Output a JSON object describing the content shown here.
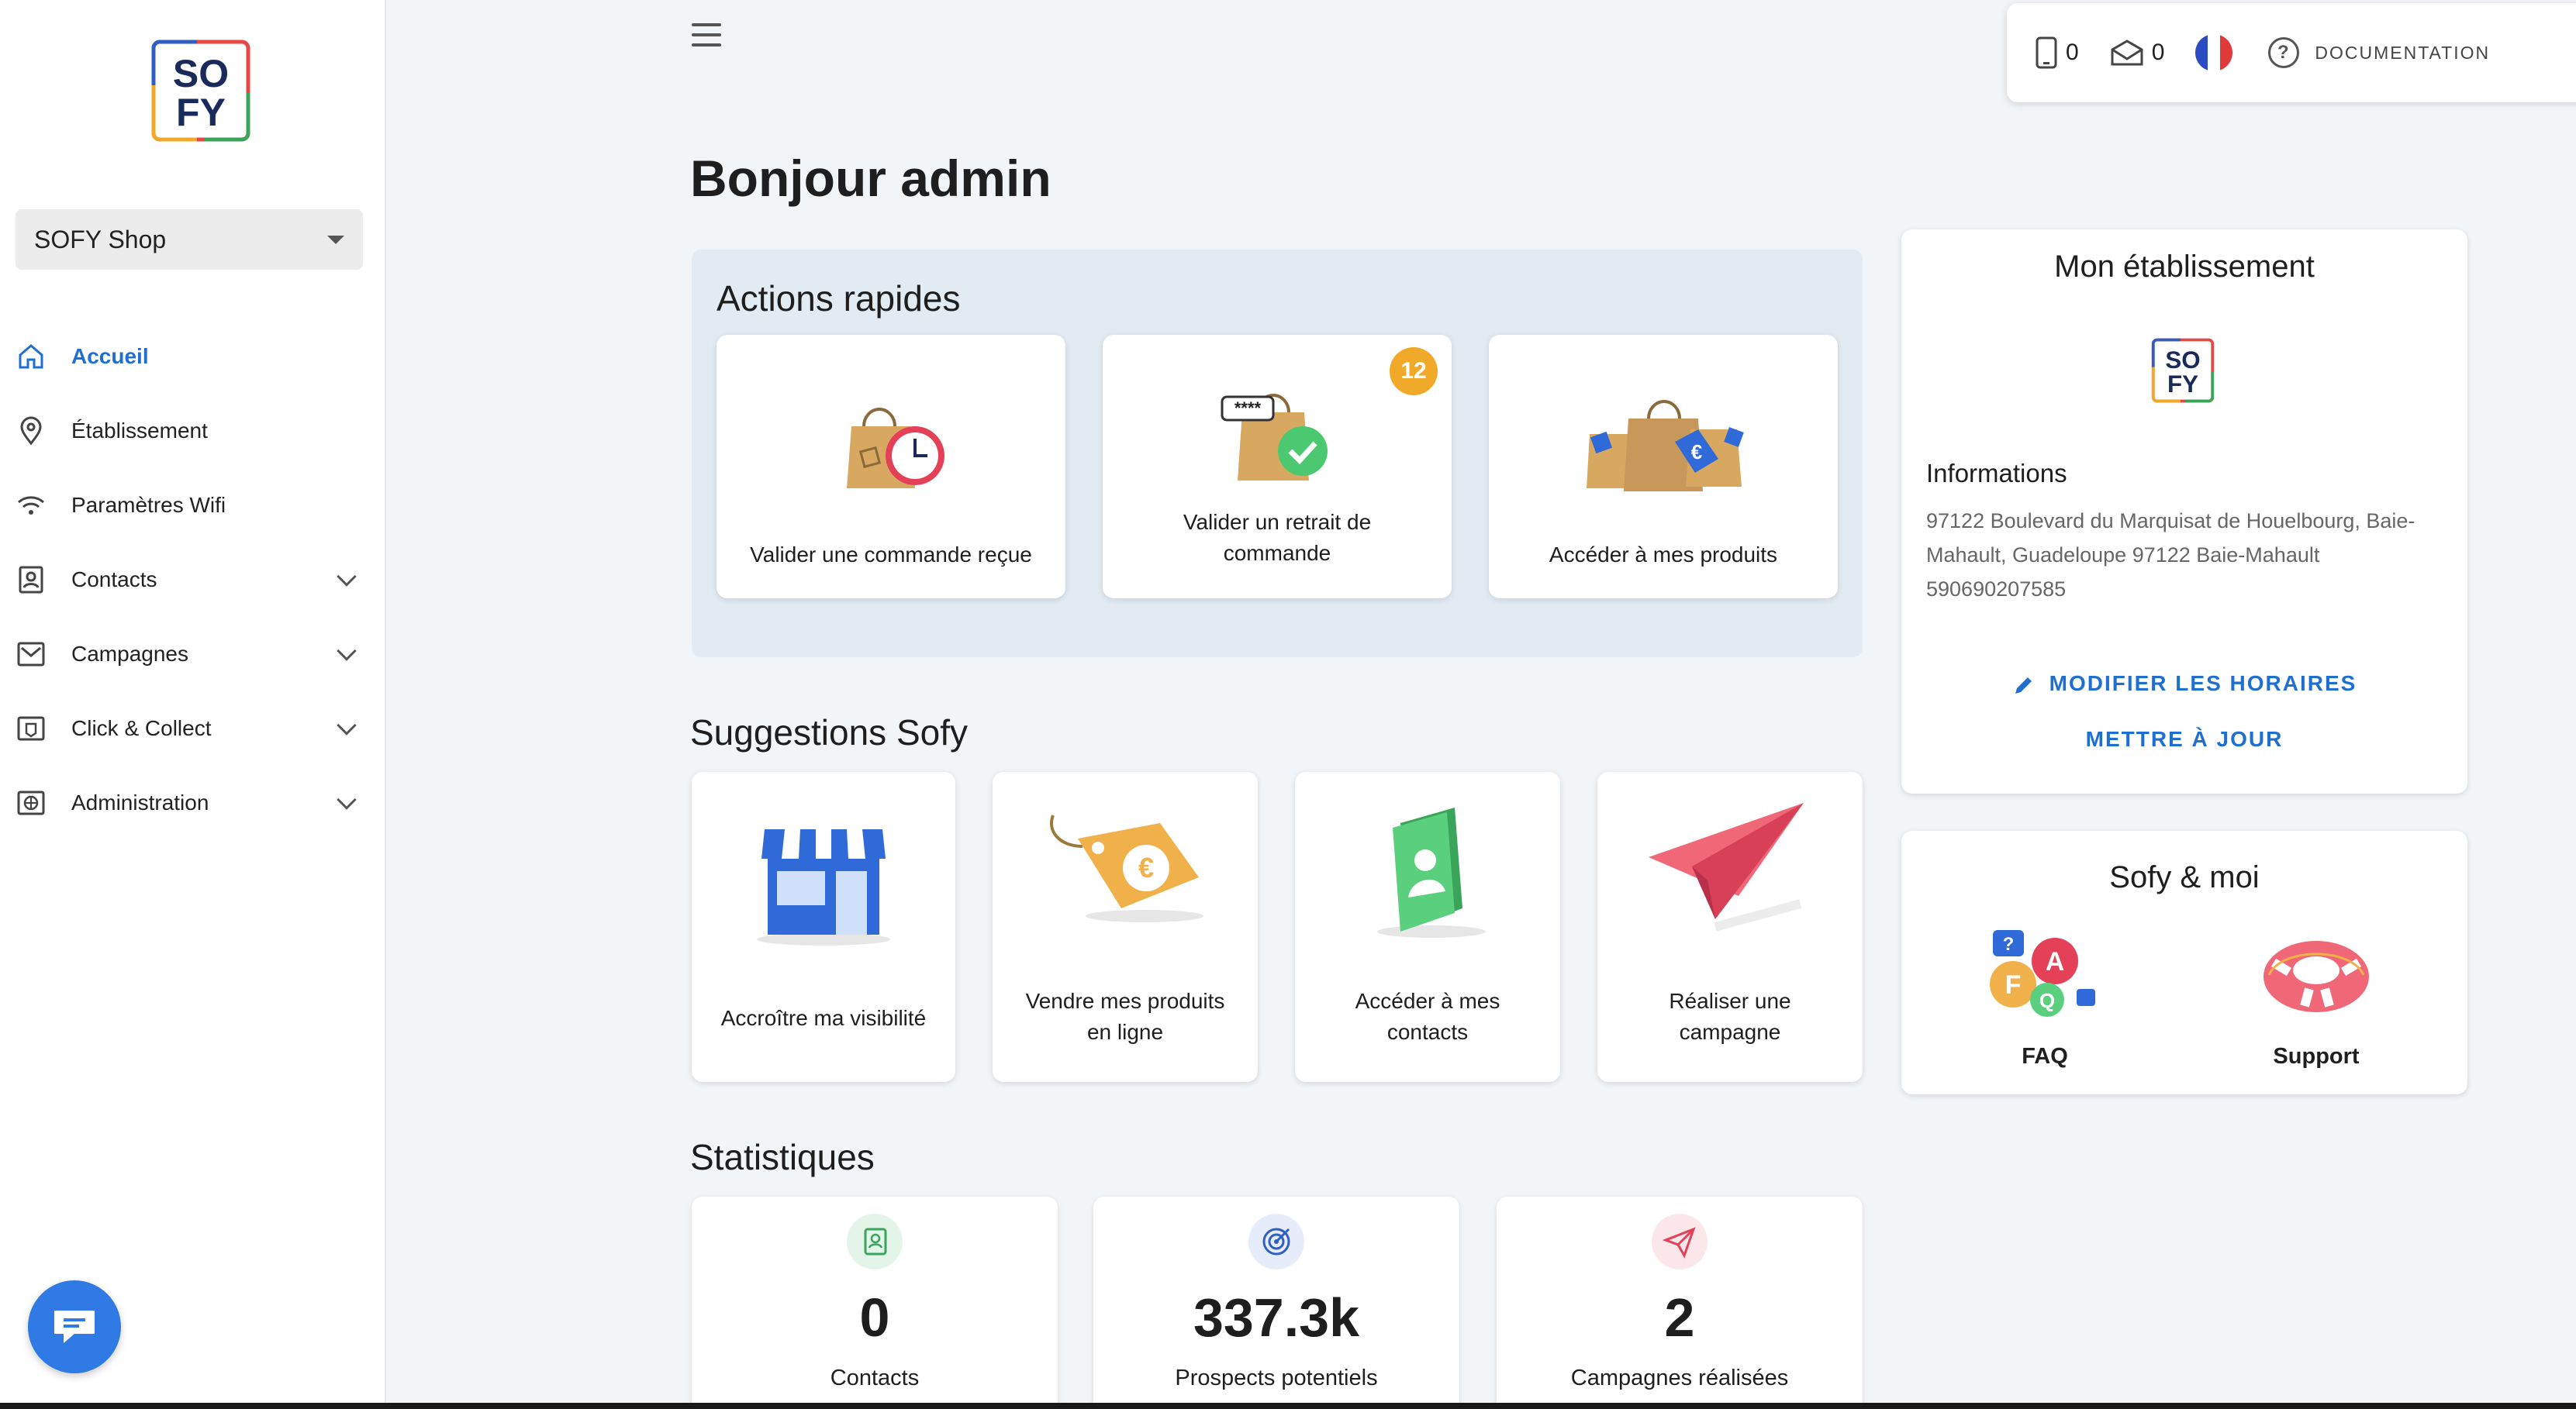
{
  "brand": {
    "logo_top": "SO",
    "logo_bottom": "FY"
  },
  "sidebar": {
    "shop_select": "SOFY Shop",
    "items": [
      {
        "label": "Accueil",
        "icon": "home-icon",
        "active": true,
        "expandable": false
      },
      {
        "label": "Établissement",
        "icon": "location-pin-icon",
        "active": false,
        "expandable": false
      },
      {
        "label": "Paramètres Wifi",
        "icon": "wifi-icon",
        "active": false,
        "expandable": false
      },
      {
        "label": "Contacts",
        "icon": "contact-card-icon",
        "active": false,
        "expandable": true
      },
      {
        "label": "Campagnes",
        "icon": "campaign-mail-icon",
        "active": false,
        "expandable": true
      },
      {
        "label": "Click & Collect",
        "icon": "tag-icon",
        "active": false,
        "expandable": true
      },
      {
        "label": "Administration",
        "icon": "globe-admin-icon",
        "active": false,
        "expandable": true
      }
    ]
  },
  "topbar": {
    "sms_count": "0",
    "mail_count": "0",
    "documentation": "DOCUMENTATION"
  },
  "greeting": "Bonjour admin",
  "quick_actions": {
    "title": "Actions rapides",
    "items": [
      {
        "label": "Valider une commande reçue",
        "icon": "bag-clock-icon"
      },
      {
        "label": "Valider un retrait de commande",
        "icon": "bag-check-icon",
        "badge": "12"
      },
      {
        "label": "Accéder à mes produits",
        "icon": "bags-euro-icon"
      }
    ]
  },
  "suggestions": {
    "title": "Suggestions Sofy",
    "items": [
      {
        "label": "Accroître ma visibilité",
        "icon": "shop-front-icon"
      },
      {
        "label": "Vendre mes produits en ligne",
        "icon": "euro-tag-icon"
      },
      {
        "label": "Accéder à mes contacts",
        "icon": "contact-book-icon"
      },
      {
        "label": "Réaliser une campagne",
        "icon": "paper-plane-icon"
      }
    ]
  },
  "establishment": {
    "title": "Mon établissement",
    "info_heading": "Informations",
    "address": "97122 Boulevard du Marquisat de Houelbourg, Baie-Mahault, Guadeloupe 97122 Baie-Mahault",
    "phone": "590690207585",
    "edit_hours": "MODIFIER LES HORAIRES",
    "update": "METTRE À JOUR"
  },
  "sofy_moi": {
    "title": "Sofy & moi",
    "faq": "FAQ",
    "support": "Support"
  },
  "stats": {
    "title": "Statistiques",
    "items": [
      {
        "value": "0",
        "label": "Contacts",
        "icon": "address-book-icon",
        "color": "#e3f5e8"
      },
      {
        "value": "337.3k",
        "label": "Prospects potentiels",
        "icon": "target-icon",
        "color": "#e6ecfa"
      },
      {
        "value": "2",
        "label": "Campagnes réalisées",
        "icon": "send-icon",
        "color": "#fbe6ea"
      }
    ]
  },
  "colors": {
    "accent": "#1f6fd1",
    "badge": "#f0a928",
    "chat": "#2f7ae5"
  }
}
